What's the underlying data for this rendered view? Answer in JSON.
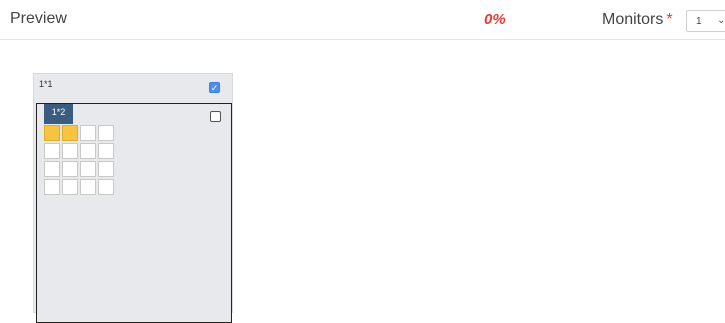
{
  "header": {
    "title": "Preview",
    "progress": "0%",
    "monitors_label": "Monitors",
    "required_mark": "*",
    "monitors_value": "1",
    "monitors_chevron": "⌄"
  },
  "colors": {
    "progress": "#e53935",
    "selected_cell": "#f5c542",
    "checkbox_checked": "#4d8ff0",
    "inner_label_bg": "#3a5c80"
  },
  "layout": {
    "outer": {
      "label": "1*1",
      "checked": true,
      "check_glyph": "✓"
    },
    "inner": {
      "label": "1*2",
      "checked": false
    },
    "grid": {
      "rows": 4,
      "cols": 4,
      "selected": [
        [
          0,
          0
        ],
        [
          0,
          1
        ]
      ]
    }
  }
}
